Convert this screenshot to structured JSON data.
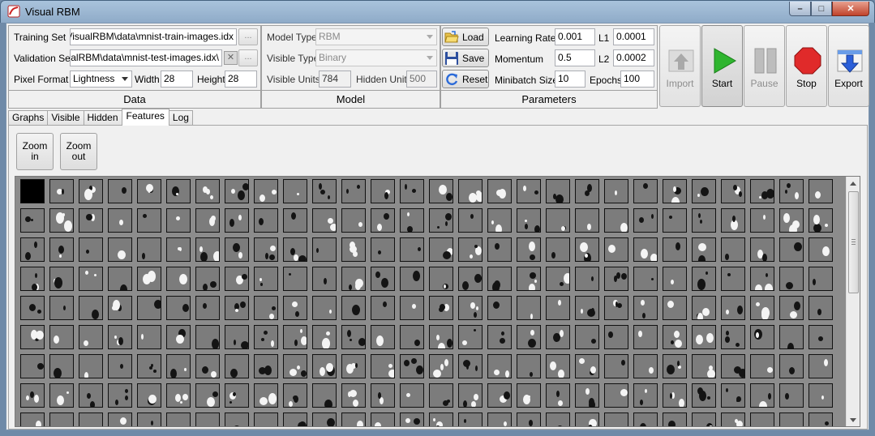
{
  "window": {
    "title": "Visual RBM",
    "minimize": "–",
    "maximize": "□",
    "close": "✕"
  },
  "data_group": {
    "title": "Data",
    "training_label": "Training Set",
    "training_value": "cts\\VisualRBM\\data\\mnist-train-images.idx",
    "validation_label": "Validation Set",
    "validation_value": "\\VisualRBM\\data\\mnist-test-images.idx",
    "browse_label": "...",
    "clear_label": "✕",
    "pixel_format_label": "Pixel Format",
    "pixel_format_value": "Lightness",
    "width_label": "Width",
    "width_value": "28",
    "height_label": "Height",
    "height_value": "28"
  },
  "model_group": {
    "title": "Model",
    "model_type_label": "Model Type",
    "model_type_value": "RBM",
    "visible_type_label": "Visible Type",
    "visible_type_value": "Binary",
    "visible_units_label": "Visible Units",
    "visible_units_value": "784",
    "hidden_units_label": "Hidden Units",
    "hidden_units_value": "500"
  },
  "params_group": {
    "title": "Parameters",
    "load_label": "Load",
    "save_label": "Save",
    "reset_label": "Reset",
    "learning_rate_label": "Learning Rate",
    "learning_rate_value": "0.001",
    "l1_label": "L1",
    "l1_value": "0.0001",
    "momentum_label": "Momentum",
    "momentum_value": "0.5",
    "l2_label": "L2",
    "l2_value": "0.0002",
    "minibatch_label": "Minibatch Size",
    "minibatch_value": "10",
    "epochs_label": "Epochs",
    "epochs_value": "100"
  },
  "toolbar": {
    "import_label": "Import",
    "start_label": "Start",
    "pause_label": "Pause",
    "stop_label": "Stop",
    "export_label": "Export"
  },
  "tabs": [
    "Graphs",
    "Visible",
    "Hidden",
    "Features",
    "Log"
  ],
  "selected_tab": "Features",
  "features_pane": {
    "zoom_in_line1": "Zoom",
    "zoom_in_line2": "in",
    "zoom_out_line1": "Zoom",
    "zoom_out_line2": "out"
  },
  "icons": {
    "app": "visual-rbm-logo-icon",
    "load": "folder-open-icon",
    "save": "floppy-disk-icon",
    "reset": "refresh-icon",
    "import": "arrow-up-icon",
    "start": "play-icon",
    "pause": "pause-icon",
    "stop": "stop-octagon-icon",
    "export": "arrow-down-icon"
  },
  "colors": {
    "start_green": "#2fb52f",
    "stop_red": "#e02a2a",
    "export_blue": "#2b5fd9",
    "feature_bg": "#7c7c7c"
  }
}
